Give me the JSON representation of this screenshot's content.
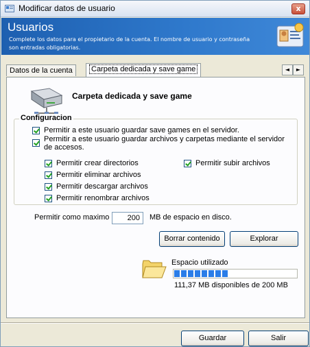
{
  "window": {
    "title": "Modificar datos de usuario",
    "close_glyph": "x"
  },
  "header": {
    "title": "Usuarios",
    "description": "Complete los datos para el propietario de la cuenta. El nombre de usuario y contraseña son entradas obligatorias.",
    "icon": "id-card-icon"
  },
  "tabs": [
    {
      "label": "Datos de la cuenta",
      "active": false
    },
    {
      "label": "Carpeta dedicada y save game",
      "active": true
    }
  ],
  "tab_arrows": {
    "left": "◄",
    "right": "►"
  },
  "panel": {
    "heading": "Carpeta dedicada y save game",
    "icon": "network-drive-icon"
  },
  "config": {
    "group_label": "Configuracion",
    "main_options": [
      {
        "label": "Permitir a este usuario guardar save games en el servidor.",
        "checked": true
      },
      {
        "label": "Permitir a este usuario guardar archivos y carpetas mediante el servidor de accesos.",
        "checked": true
      }
    ],
    "left_options": [
      {
        "label": "Permitir crear directorios",
        "checked": true
      },
      {
        "label": "Permitir eliminar archivos",
        "checked": true
      },
      {
        "label": "Permitir descargar archivos",
        "checked": true
      },
      {
        "label": "Permitir renombrar archivos",
        "checked": true
      }
    ],
    "right_options": [
      {
        "label": "Permitir subir archivos",
        "checked": true
      }
    ]
  },
  "quota": {
    "label": "Permitir como maximo",
    "value": "200",
    "unit": "MB de espacio en disco."
  },
  "buttons": {
    "clear": "Borrar contenido",
    "explore": "Explorar",
    "save": "Guardar",
    "exit": "Salir"
  },
  "usage": {
    "label": "Espacio utilizado",
    "fill_fraction": 0.45,
    "available_text": "111,37 MB disponibles de 200 MB",
    "bar_color": "#2a7de8"
  },
  "colors": {
    "header_bg": "#2f79cc",
    "checkmark": "#21a121"
  }
}
